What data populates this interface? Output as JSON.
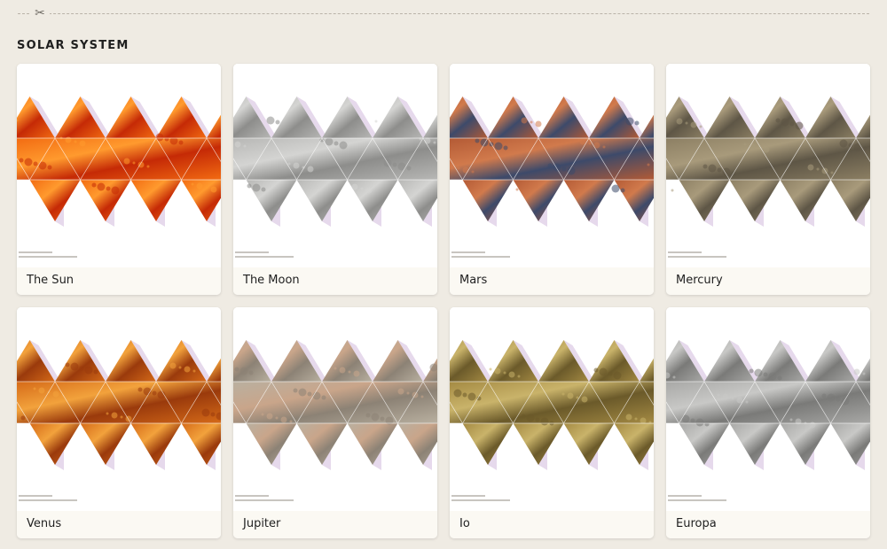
{
  "section": {
    "title": "SOLAR SYSTEM"
  },
  "icons": {
    "cut": "scissors-icon"
  },
  "colors": {
    "background": "#efebe3",
    "card": "#ffffff",
    "fold_tab": "#e6d9ec",
    "fold_line": "#ffffff"
  },
  "planets": [
    {
      "name": "The Sun",
      "colors": [
        "#f26b12",
        "#c52a06",
        "#ff9a2e"
      ]
    },
    {
      "name": "The Moon",
      "colors": [
        "#b7b7b5",
        "#8d8d8b",
        "#d4d4d2"
      ]
    },
    {
      "name": "Mars",
      "colors": [
        "#b35a35",
        "#3d4a6a",
        "#d17a4c"
      ]
    },
    {
      "name": "Mercury",
      "colors": [
        "#8c7f63",
        "#5e5646",
        "#a89a7b"
      ]
    },
    {
      "name": "Venus",
      "colors": [
        "#d56a18",
        "#9a3a0c",
        "#f2a23c"
      ]
    },
    {
      "name": "Jupiter",
      "colors": [
        "#b9b0a0",
        "#8c8275",
        "#c9a58a"
      ]
    },
    {
      "name": "Io",
      "colors": [
        "#a48a43",
        "#6b5a2a",
        "#c9b36a"
      ]
    },
    {
      "name": "Europa",
      "colors": [
        "#a8a8a6",
        "#7a7a78",
        "#c8c8c6"
      ]
    }
  ]
}
